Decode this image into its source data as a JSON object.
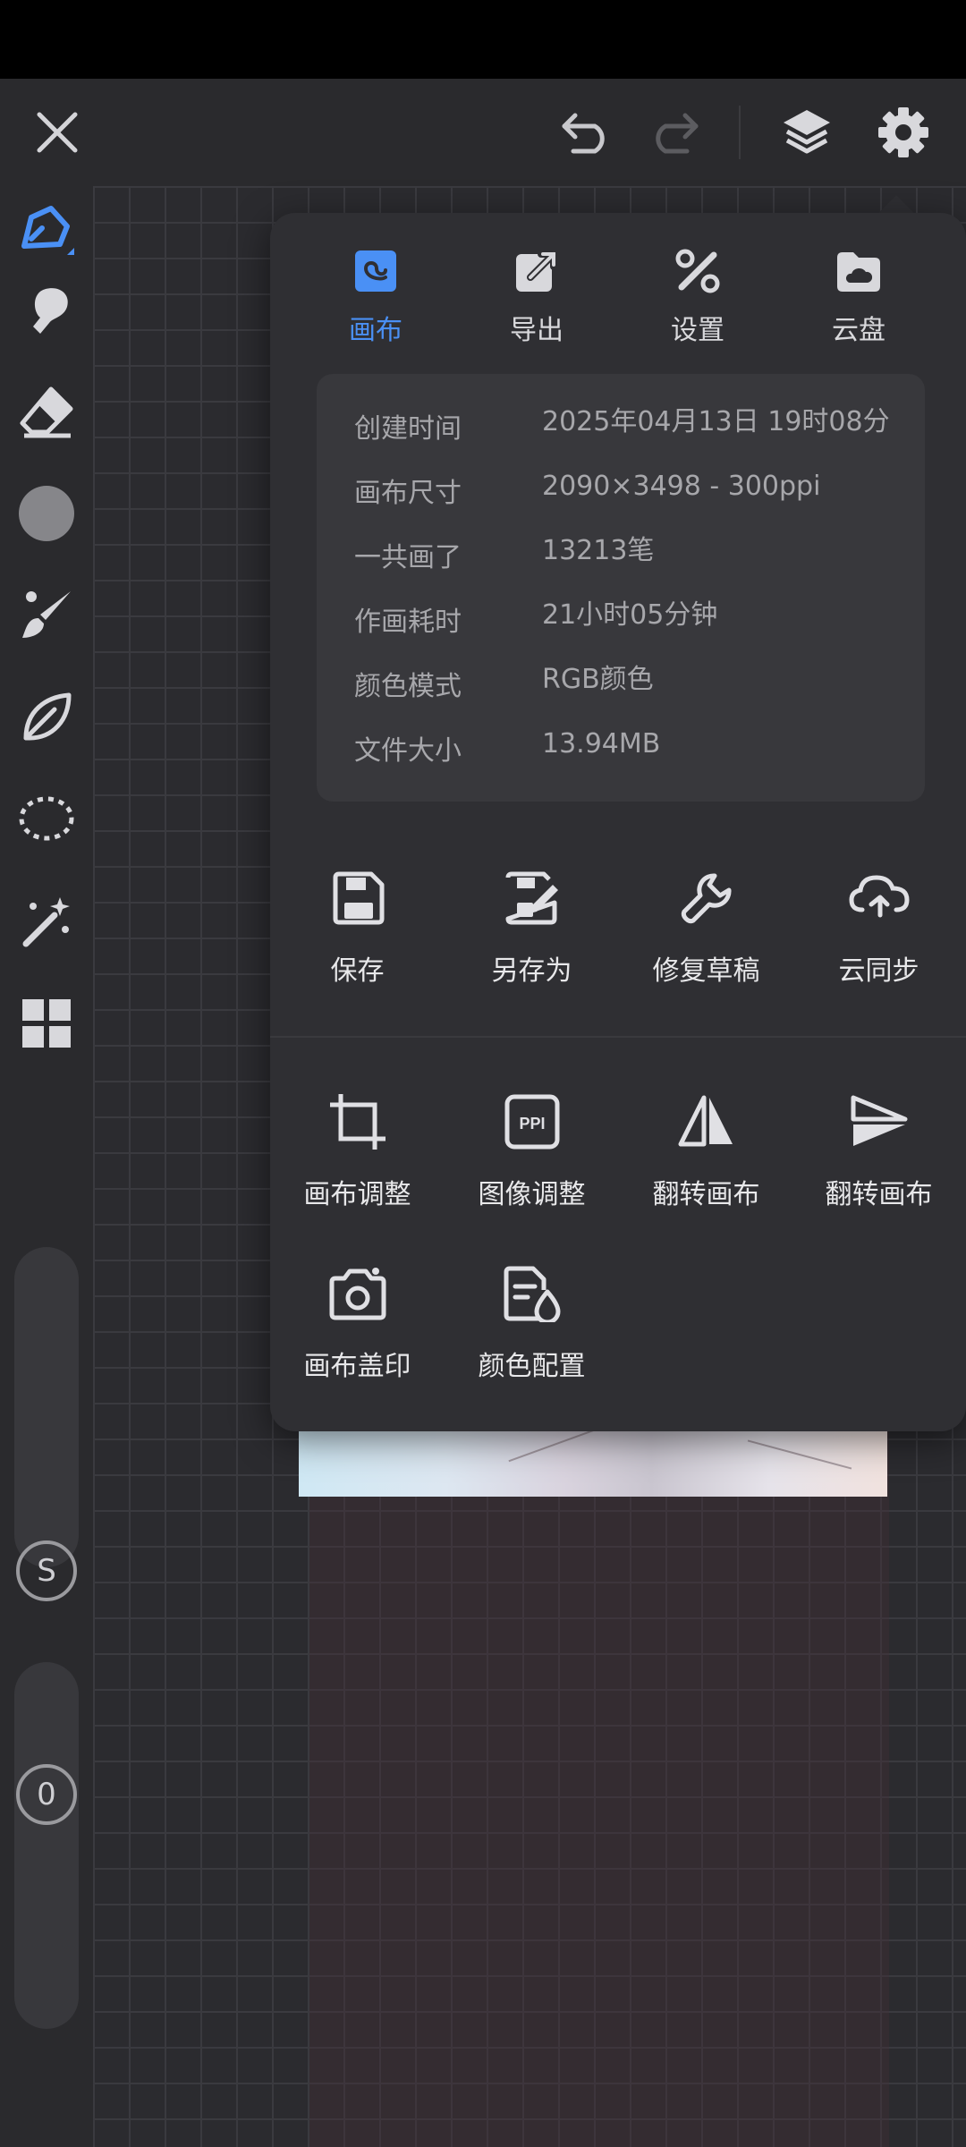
{
  "colors": {
    "accent": "#4a90f5",
    "panel": "#2f2f33",
    "toolbar": "#2a2a2d"
  },
  "topbar": {
    "close": "close-icon",
    "undo": "undo-icon",
    "redo": "redo-icon",
    "layers": "layers-icon",
    "settings": "gear-icon"
  },
  "sidebar": {
    "tools": [
      "pen-icon",
      "smudge-icon",
      "eraser-icon",
      "color-swatch",
      "brush-icon",
      "leaf-icon",
      "lasso-icon",
      "magic-wand-icon",
      "grid-icon"
    ],
    "size_slider_label": "S",
    "opacity_slider_label": "0"
  },
  "panel": {
    "tabs": [
      {
        "label": "画布",
        "icon": "canvas-icon",
        "active": true
      },
      {
        "label": "导出",
        "icon": "export-icon",
        "active": false
      },
      {
        "label": "设置",
        "icon": "tools-icon",
        "active": false
      },
      {
        "label": "云盘",
        "icon": "cloud-drive-icon",
        "active": false
      }
    ],
    "info": [
      {
        "key": "创建时间",
        "value": "2025年04月13日 19时08分"
      },
      {
        "key": "画布尺寸",
        "value": "2090×3498 - 300ppi"
      },
      {
        "key": "一共画了",
        "value": "13213笔"
      },
      {
        "key": "作画耗时",
        "value": "21小时05分钟"
      },
      {
        "key": "颜色模式",
        "value": "RGB颜色"
      },
      {
        "key": "文件大小",
        "value": "13.94MB"
      }
    ],
    "actions": [
      {
        "label": "保存",
        "icon": "save-icon"
      },
      {
        "label": "另存为",
        "icon": "save-as-icon"
      },
      {
        "label": "修复草稿",
        "icon": "wrench-icon"
      },
      {
        "label": "云同步",
        "icon": "cloud-sync-icon"
      }
    ],
    "canvas_tools": [
      {
        "label": "画布调整",
        "icon": "crop-icon"
      },
      {
        "label": "图像调整",
        "icon": "ppi-icon",
        "badge": "PPI"
      },
      {
        "label": "翻转画布",
        "icon": "flip-horizontal-icon"
      },
      {
        "label": "翻转画布",
        "icon": "flip-vertical-icon"
      },
      {
        "label": "画布盖印",
        "icon": "camera-icon"
      },
      {
        "label": "颜色配置",
        "icon": "color-profile-icon"
      }
    ]
  }
}
